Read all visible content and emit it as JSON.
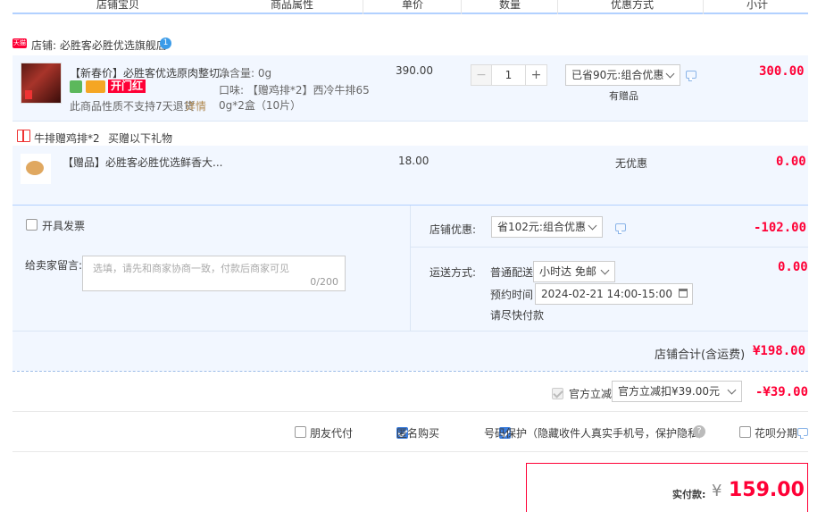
{
  "columns": {
    "shop_item": "店铺宝贝",
    "attrs": "商品属性",
    "unit_price": "单价",
    "qty": "数量",
    "promo": "优惠方式",
    "subtotal": "小计"
  },
  "shop": {
    "badge": "天猫",
    "label": "店铺: 必胜客必胜优选旗舰店",
    "ww_icon": "wangwang-chat-icon"
  },
  "item": {
    "title": "【新春价】必胜客优选原肉整切...",
    "tags": [
      "开门红"
    ],
    "note": "此商品性质不支持7天退货",
    "note_link": "详情",
    "attr_net": "净含量: 0g",
    "attr_flavor": "口味: 【赠鸡排*2】西冷牛排65",
    "attr_flavor2": "0g*2盒（10片）",
    "price": "390.00",
    "qty": "1",
    "minus": "−",
    "plus": "+",
    "promo_select": "已省90元:组合优惠",
    "has_gift": "有赠品",
    "subtotal": "300.00"
  },
  "gift_group": {
    "label": "牛排赠鸡排*2",
    "sub": "买赠以下礼物"
  },
  "gift": {
    "title": "【赠品】必胜客必胜优选鲜香大...",
    "price": "18.00",
    "promo": "无优惠",
    "subtotal": "0.00"
  },
  "invoice": {
    "label": "开具发票"
  },
  "shop_discount": {
    "label": "店铺优惠:",
    "select": "省102元:组合优惠",
    "amount": "-102.00"
  },
  "message": {
    "label": "给卖家留言:",
    "placeholder": "选填，请先和商家协商一致，付款后商家可见",
    "counter": "0/200"
  },
  "shipping": {
    "label": "运送方式:",
    "method": "普通配送",
    "select": "小时达 免邮",
    "amount": "0.00",
    "reserve_label": "预约时间",
    "reserve_value": "2024-02-21 14:00-15:00",
    "pay_hint": "请尽快付款"
  },
  "shop_total": {
    "label": "店铺合计(含运费)",
    "amount": "¥198.00"
  },
  "official": {
    "label": "官方立减",
    "select": "官方立减扣¥39.00元",
    "amount": "-¥39.00"
  },
  "options": {
    "friend_pay": "朋友代付",
    "anonymous": "匿名购买",
    "number_protect": "号码保护（隐藏收件人真实手机号，保护隐私）",
    "huabei": "花呗分期"
  },
  "pay": {
    "label": "实付款:",
    "currency": "¥",
    "amount": "159.00"
  },
  "colors": {
    "accent": "#ff0036",
    "link": "#3b7ddd",
    "row_bg": "#f2f7ff"
  }
}
